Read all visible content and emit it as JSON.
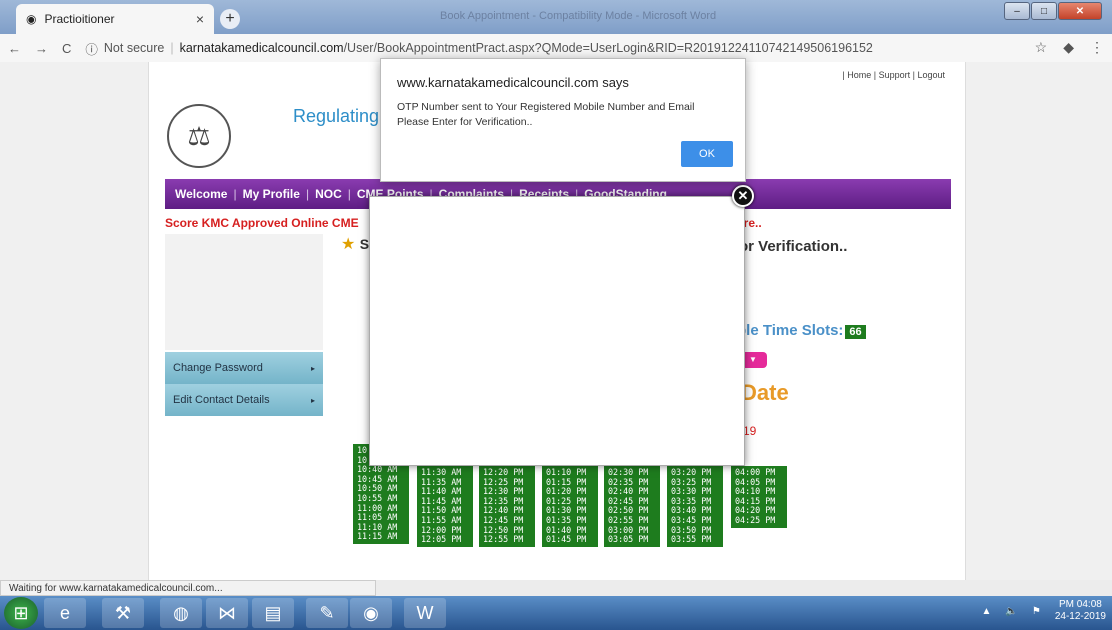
{
  "browser": {
    "tab_title": "Practioitioner",
    "tab_close": "×",
    "new_tab": "+",
    "window_title": "Book Appointment - Compatibility Mode - Microsoft Word",
    "nav_back": "←",
    "nav_forward": "→",
    "nav_reload": "C",
    "security_icon": "ⓘ",
    "security_label": "Not secure",
    "url_host": "karnatakamedicalcouncil.com",
    "url_path": "/User/BookAppointmentPract.aspx?QMode=UserLogin&RID=R20191224110742149506196152",
    "bookmark_icon": "☆",
    "menu_icon": "⋮"
  },
  "page": {
    "top_links": "| Home  | Support  | Logout",
    "title_fragment": "Regulating",
    "nav": [
      "Welcome",
      "My Profile",
      "NOC",
      "CME Points",
      "Complaints",
      "Receipts",
      "GoodStanding"
    ],
    "nav_sep": "|",
    "marquee_left": "Score KMC Approved Online CME",
    "marquee_right": "ere..",
    "otp_fragment": "or Verification..",
    "star": "★",
    "star_letter": "S",
    "menu": [
      "Change Password",
      "Edit Contact Details"
    ],
    "slots_label": "ble Time Slots:",
    "slots_count": "66",
    "date_fragment": "Date",
    "year_fragment": "19"
  },
  "time_slots": {
    "col1": [
      "10",
      "10",
      "10:40 AM",
      "10:45 AM",
      "10:50 AM",
      "10:55 AM",
      "11:00 AM",
      "11:05 AM",
      "11:10 AM",
      "11:15 AM"
    ],
    "col2": [
      "11:30 AM",
      "11:35 AM",
      "11:40 AM",
      "11:45 AM",
      "11:50 AM",
      "11:55 AM",
      "12:00 PM",
      "12:05 PM"
    ],
    "col3": [
      "12:20 PM",
      "12:25 PM",
      "12:30 PM",
      "12:35 PM",
      "12:40 PM",
      "12:45 PM",
      "12:50 PM",
      "12:55 PM"
    ],
    "col4": [
      "01:10 PM",
      "01:15 PM",
      "01:20 PM",
      "01:25 PM",
      "01:30 PM",
      "01:35 PM",
      "01:40 PM",
      "01:45 PM"
    ],
    "col5": [
      "02:30 PM",
      "02:35 PM",
      "02:40 PM",
      "02:45 PM",
      "02:50 PM",
      "02:55 PM",
      "03:00 PM",
      "03:05 PM"
    ],
    "col6": [
      "03:20 PM",
      "03:25 PM",
      "03:30 PM",
      "03:35 PM",
      "03:40 PM",
      "03:45 PM",
      "03:50 PM",
      "03:55 PM"
    ],
    "col7": [
      "04:00 PM",
      "04:05 PM",
      "04:10 PM",
      "04:15 PM",
      "04:20 PM",
      "04:25 PM"
    ]
  },
  "alert": {
    "origin": "www.karnatakamedicalcouncil.com says",
    "message": "OTP Number sent to Your Registered Mobile Number and Email Please Enter for Verification..",
    "ok_label": "OK"
  },
  "popup": {
    "close_label": "✕"
  },
  "status_text": "Waiting for www.karnatakamedicalcouncil.com...",
  "taskbar": {
    "clock_time": "PM 04:08",
    "clock_date": "24-12-2019"
  }
}
